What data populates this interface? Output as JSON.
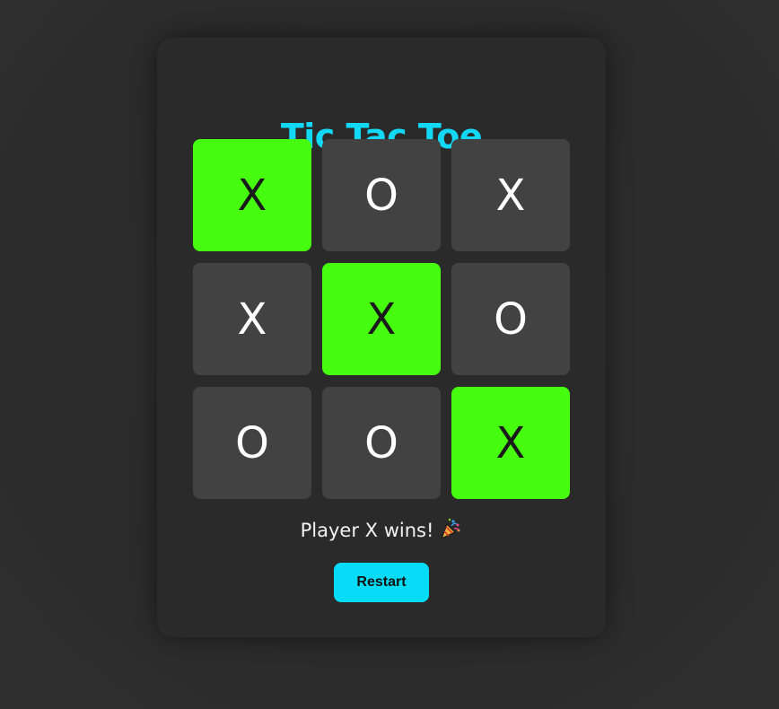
{
  "title": "Tic Tac Toe",
  "board": {
    "cells": [
      "X",
      "O",
      "X",
      "X",
      "X",
      "O",
      "O",
      "O",
      "X"
    ],
    "winning_cells": [
      0,
      4,
      8
    ]
  },
  "status": {
    "text": "Player X wins!",
    "icon": "party-popper-icon"
  },
  "restart_label": "Restart",
  "colors": {
    "accent": "#12d8f5",
    "win_cell": "#46fc0f",
    "cell": "#424242",
    "card": "#2a2a2a",
    "background": "#2c2c2c",
    "button": "#06dcf7"
  }
}
